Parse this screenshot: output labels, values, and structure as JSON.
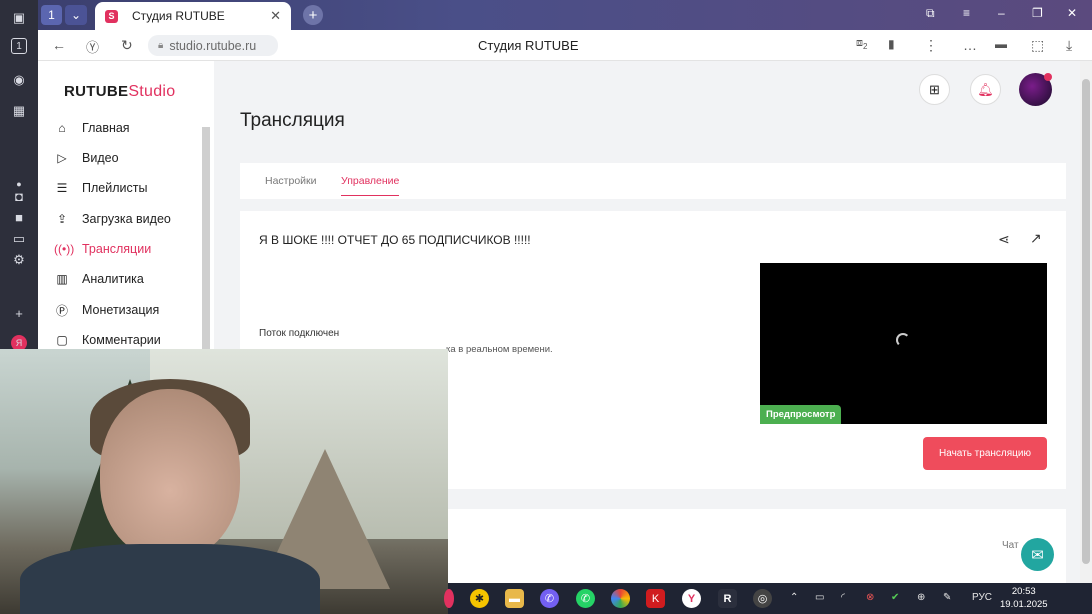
{
  "browser": {
    "tab_count": "1",
    "tab_title": "Студия RUTUBE",
    "url": "studio.rutube.ru",
    "page_title": "Студия RUTUBE",
    "collections_count": "2"
  },
  "brand": {
    "logo_main": "RUTUBE",
    "logo_studio": "Studio",
    "accent": "#e1315f"
  },
  "sidebar": {
    "items": [
      {
        "label": "Главная",
        "icon": "home-icon"
      },
      {
        "label": "Видео",
        "icon": "play-icon"
      },
      {
        "label": "Плейлисты",
        "icon": "list-icon"
      },
      {
        "label": "Загрузка видео",
        "icon": "upload-icon"
      },
      {
        "label": "Трансляции",
        "icon": "broadcast-icon",
        "active": true
      },
      {
        "label": "Аналитика",
        "icon": "analytics-icon"
      },
      {
        "label": "Монетизация",
        "icon": "monetization-icon"
      },
      {
        "label": "Комментарии",
        "icon": "comments-icon"
      }
    ]
  },
  "main": {
    "heading": "Трансляция",
    "tabs": [
      {
        "label": "Настройки"
      },
      {
        "label": "Управление",
        "active": true
      }
    ],
    "stream_title": "Я В ШОКЕ !!!! ОТЧЕТ ДО 65 ПОДПИСЧИКОВ !!!!!",
    "status_label": "Поток подключен",
    "status_desc_visible": "ка в реальном времени.",
    "preview_badge": "Предпросмотр",
    "start_button": "Начать трансляцию",
    "chat_label": "Чат"
  },
  "taskbar": {
    "lang": "РУС",
    "time": "20:53",
    "date": "19.01.2025"
  }
}
